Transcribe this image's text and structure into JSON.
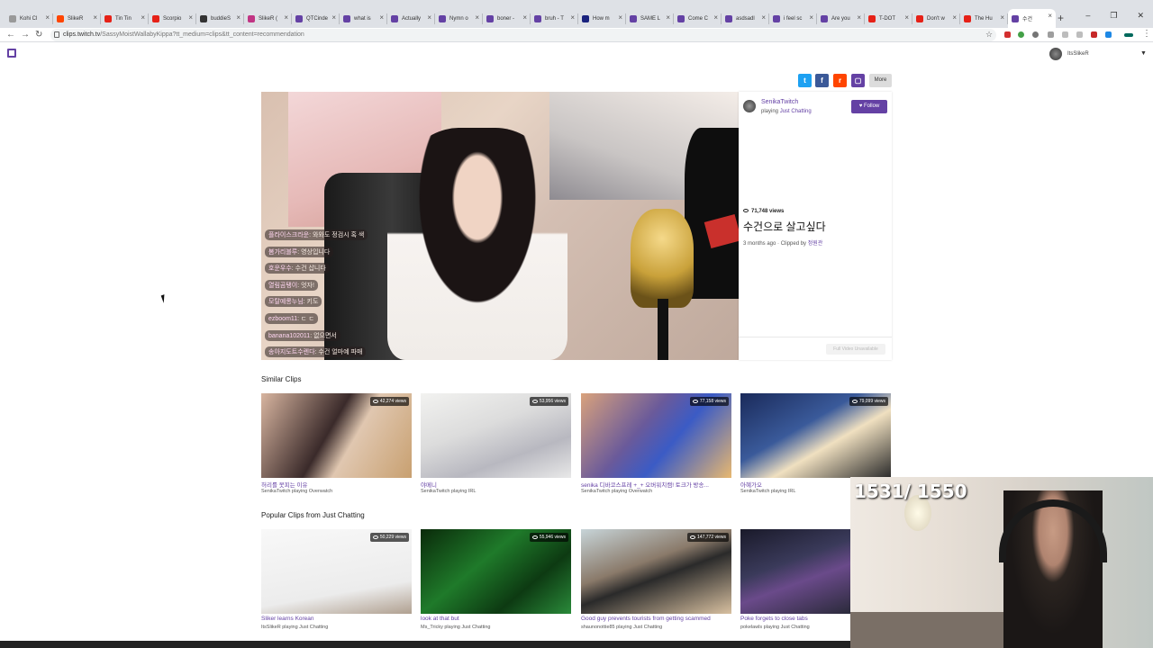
{
  "browser": {
    "tabs": [
      {
        "label": "Kohi Cl",
        "color": "#999"
      },
      {
        "label": "SlikeR",
        "color": "#ff4500"
      },
      {
        "label": "Tin Tin",
        "color": "#e62117"
      },
      {
        "label": "Scorpio",
        "color": "#e62117"
      },
      {
        "label": "buddieS",
        "color": "#333"
      },
      {
        "label": "SlikeR (",
        "color": "#c13584"
      },
      {
        "label": "QTCinde",
        "color": "#6441a4"
      },
      {
        "label": "what is",
        "color": "#6441a4"
      },
      {
        "label": "Actually",
        "color": "#6441a4"
      },
      {
        "label": "Nymn o",
        "color": "#6441a4"
      },
      {
        "label": "boner -",
        "color": "#6441a4"
      },
      {
        "label": "bruh - T",
        "color": "#6441a4"
      },
      {
        "label": "How m",
        "color": "#1a237e"
      },
      {
        "label": "SAME L",
        "color": "#6441a4"
      },
      {
        "label": "Come C",
        "color": "#6441a4"
      },
      {
        "label": "asdsadl",
        "color": "#6441a4"
      },
      {
        "label": "i feel sc",
        "color": "#6441a4"
      },
      {
        "label": "Are you",
        "color": "#6441a4"
      },
      {
        "label": "T-DOT",
        "color": "#e62117"
      },
      {
        "label": "Don't w",
        "color": "#e62117"
      },
      {
        "label": "The Hu",
        "color": "#e62117"
      },
      {
        "label": "수건",
        "color": "#6441a4"
      }
    ],
    "new_tab": "+",
    "url_domain": "clips.twitch.tv",
    "url_path": "/SassyMoistWallabyKippa?tt_medium=clips&tt_content=recommendation",
    "window_controls": [
      "–",
      "❐",
      "✕"
    ]
  },
  "header": {
    "username": "ItsSlikeR"
  },
  "share": {
    "buttons": [
      {
        "icon": "twitter-icon",
        "glyph": "t",
        "color": "#1da1f2"
      },
      {
        "icon": "facebook-icon",
        "glyph": "f",
        "color": "#3b5998"
      },
      {
        "icon": "reddit-icon",
        "glyph": "r",
        "color": "#ff4500"
      },
      {
        "icon": "twitch-share-icon",
        "glyph": "▢",
        "color": "#6441a4"
      }
    ],
    "more_label": "More"
  },
  "clip": {
    "channel": "SenikaTwitch",
    "playing_prefix": "playing",
    "game": "Just Chatting",
    "follow_label": "Follow",
    "views": "71,748 views",
    "title": "수건으로 살고싶다",
    "age": "3 months ago · Clipped by",
    "clipper": "정원관",
    "full_video_label": "Full Video Unavailable",
    "chat": [
      {
        "name": "플라이스크라운",
        "text": ": 와와도 정검시 혹 색"
      },
      {
        "name": "봄가리블루",
        "text": ": 영상입니다"
      },
      {
        "name": "호운우수",
        "text": ": 수건 삽니다"
      },
      {
        "name": "열림곰탱이",
        "text": ": 엇자!"
      },
      {
        "name": "모탈예롱누님",
        "text": ": 키도"
      },
      {
        "name": "ezboom11",
        "text": ": ㄷ ㄷ"
      },
      {
        "name": "banana102011",
        "text": ": 없으면서"
      },
      {
        "name": "송아지도트수렌다",
        "text": ": 수건 얼마예 파매"
      }
    ]
  },
  "similar": {
    "heading": "Similar Clips",
    "items": [
      {
        "views": "42,274 views",
        "title": "허리를 못피는 이유",
        "by": "SenikaTwitch playing Overwatch"
      },
      {
        "views": "53,956 views",
        "title": "야메니",
        "by": "SenikaTwitch playing IRL"
      },
      {
        "views": "77,158 views",
        "title": "senika 디바코스프레 +_+ 오버워치캠! 토크가 방송...",
        "by": "SenikaTwitch playing Overwatch"
      },
      {
        "views": "79,099 views",
        "title": "아혜가오",
        "by": "SenikaTwitch playing IRL"
      }
    ]
  },
  "popular": {
    "heading": "Popular Clips from Just Chatting",
    "items": [
      {
        "views": "50,229 views",
        "title": "Sliker learns Korean",
        "by": "ItsSlikeR playing Just Chatting"
      },
      {
        "views": "55,946 views",
        "title": "look at that but",
        "by": "Ms_Tricky playing Just Chatting"
      },
      {
        "views": "147,772 views",
        "title": "Good guy prevents tourists from getting scammed",
        "by": "shaunonottie85 playing Just Chatting"
      },
      {
        "views": "",
        "title": "Poke forgets to close tabs",
        "by": "pokelawls playing Just Chatting"
      }
    ]
  },
  "webcam": {
    "counter": "1531/ 1550"
  }
}
